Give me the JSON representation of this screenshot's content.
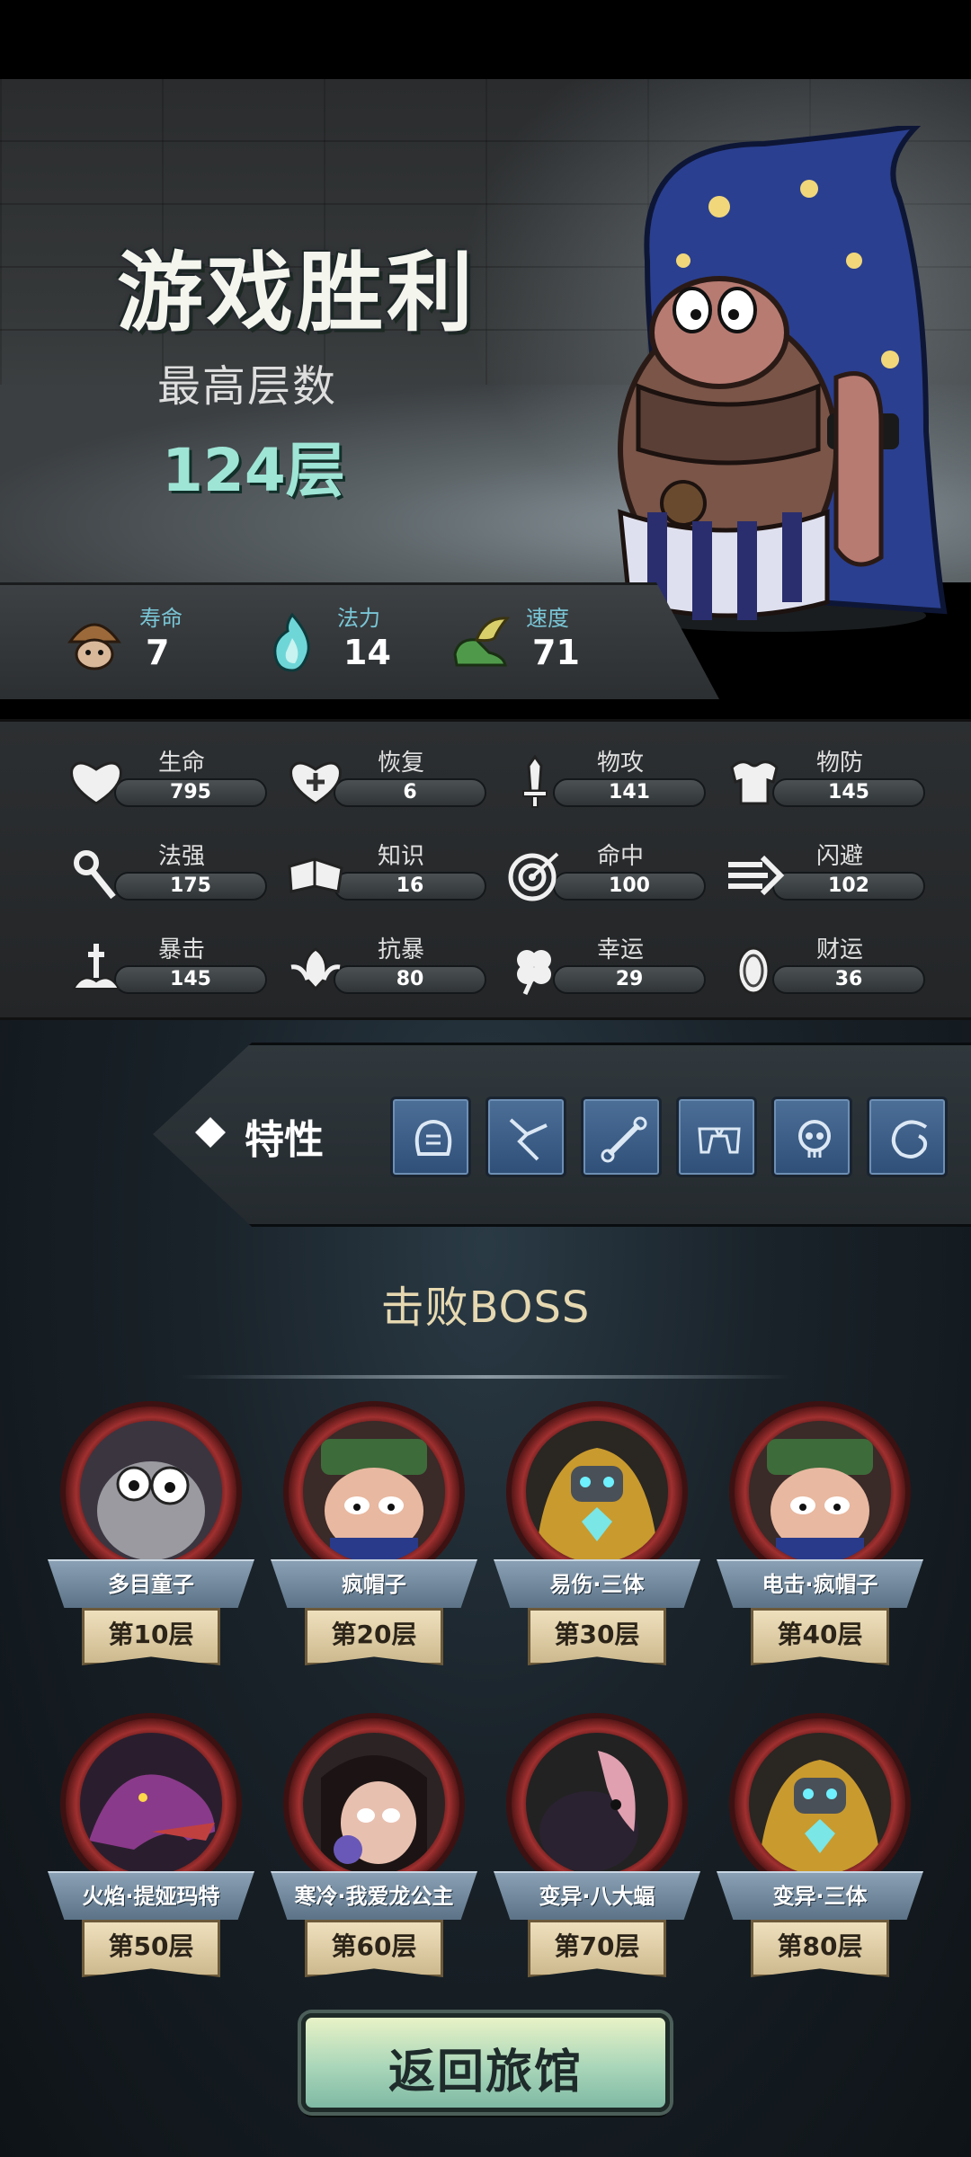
{
  "header": {
    "title": "游戏胜利",
    "subtitle": "最高层数",
    "floors": "124层"
  },
  "basic_stats": [
    {
      "label": "寿命",
      "value": "7",
      "icon": "mushroom-icon"
    },
    {
      "label": "法力",
      "value": "14",
      "icon": "flame-icon"
    },
    {
      "label": "速度",
      "value": "71",
      "icon": "wing-shoe-icon"
    }
  ],
  "stats": [
    {
      "label": "生命",
      "value": "795",
      "icon": "heart-icon"
    },
    {
      "label": "恢复",
      "value": "6",
      "icon": "heart-plus-icon"
    },
    {
      "label": "物攻",
      "value": "141",
      "icon": "sword-icon"
    },
    {
      "label": "物防",
      "value": "145",
      "icon": "armor-icon"
    },
    {
      "label": "法强",
      "value": "175",
      "icon": "staff-icon"
    },
    {
      "label": "知识",
      "value": "16",
      "icon": "book-icon"
    },
    {
      "label": "命中",
      "value": "100",
      "icon": "target-icon"
    },
    {
      "label": "闪避",
      "value": "102",
      "icon": "dash-arrow-icon"
    },
    {
      "label": "暴击",
      "value": "145",
      "icon": "crit-dagger-icon"
    },
    {
      "label": "抗暴",
      "value": "80",
      "icon": "shield-leaf-icon"
    },
    {
      "label": "幸运",
      "value": "29",
      "icon": "clover-icon"
    },
    {
      "label": "财运",
      "value": "36",
      "icon": "coin-icon"
    }
  ],
  "traits": {
    "label": "特性",
    "icons": [
      "trait-gauntlet-icon",
      "trait-crack-icon",
      "trait-bone-icon",
      "trait-pistols-icon",
      "trait-skull-icon",
      "trait-swirl-icon"
    ]
  },
  "bosses_heading": "击败BOSS",
  "bosses": [
    {
      "name": "多目童子",
      "floor": "第10层"
    },
    {
      "name": "疯帽子",
      "floor": "第20层"
    },
    {
      "name": "易伤·三体",
      "floor": "第30层"
    },
    {
      "name": "电击·疯帽子",
      "floor": "第40层"
    },
    {
      "name": "火焰·提娅玛特",
      "floor": "第50层"
    },
    {
      "name": "寒冷·我爱龙公主",
      "floor": "第60层"
    },
    {
      "name": "变异·八大蝠",
      "floor": "第70层"
    },
    {
      "name": "变异·三体",
      "floor": "第80层"
    }
  ],
  "return_button": "返回旅馆"
}
